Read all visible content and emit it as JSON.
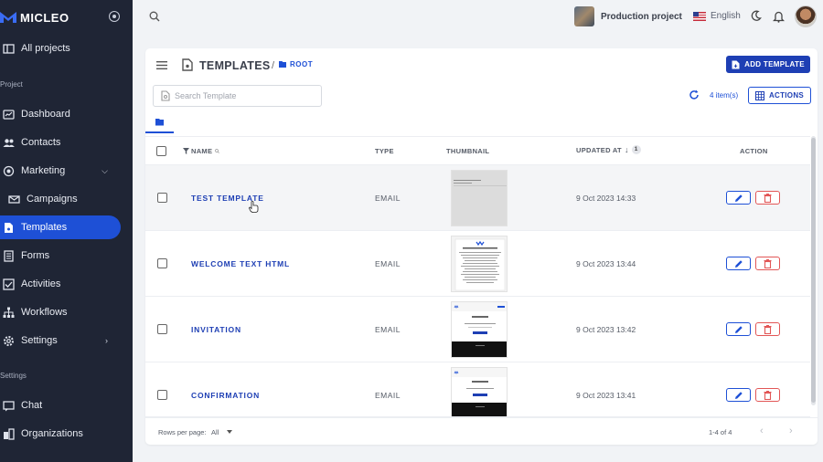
{
  "brand": {
    "name": "MICLEO"
  },
  "sidebar": {
    "all_projects": "All projects",
    "section_project": "Project",
    "section_settings": "Settings",
    "items": [
      {
        "label": "Dashboard",
        "icon": "dashboard-icon"
      },
      {
        "label": "Contacts",
        "icon": "contacts-icon"
      },
      {
        "label": "Marketing",
        "icon": "marketing-icon",
        "chevron": "down"
      },
      {
        "label": "Campaigns",
        "icon": "campaigns-icon"
      },
      {
        "label": "Templates",
        "icon": "templates-icon",
        "active": true
      },
      {
        "label": "Forms",
        "icon": "forms-icon"
      },
      {
        "label": "Activities",
        "icon": "activities-icon"
      },
      {
        "label": "Workflows",
        "icon": "workflows-icon"
      },
      {
        "label": "Settings",
        "icon": "settings-icon",
        "chevron": "right"
      }
    ],
    "settings_items": [
      {
        "label": "Chat",
        "icon": "chat-icon"
      },
      {
        "label": "Organizations",
        "icon": "organizations-icon"
      }
    ]
  },
  "topbar": {
    "project_name": "Production project",
    "language": "English"
  },
  "page": {
    "title": "TEMPLATES",
    "breadcrumb_sep": "/",
    "breadcrumb_root": "ROOT",
    "add_button": "ADD TEMPLATE",
    "search_placeholder": "Search Template",
    "items_count": "4 item(s)",
    "actions_button": "ACTIONS"
  },
  "table": {
    "columns": {
      "name": "NAME",
      "type": "TYPE",
      "thumbnail": "THUMBNAIL",
      "updated": "UPDATED AT",
      "sort_order": "1",
      "action": "ACTION"
    },
    "rows": [
      {
        "name": "TEST TEMPLATE",
        "type": "EMAIL",
        "updated": "9 Oct 2023 14:33"
      },
      {
        "name": "WELCOME TEXT HTML",
        "type": "EMAIL",
        "updated": "9 Oct 2023 13:44"
      },
      {
        "name": "INVITATION",
        "type": "EMAIL",
        "updated": "9 Oct 2023 13:42"
      },
      {
        "name": "CONFIRMATION",
        "type": "EMAIL",
        "updated": "9 Oct 2023 13:41"
      }
    ]
  },
  "footer": {
    "rows_per_page_label": "Rows per page:",
    "rows_per_page_value": "All",
    "range": "1-4 of 4"
  },
  "colors": {
    "primary": "#1e3fb4",
    "accent": "#1e50d6",
    "danger": "#e25656",
    "sidebar_bg": "#1f2535"
  }
}
